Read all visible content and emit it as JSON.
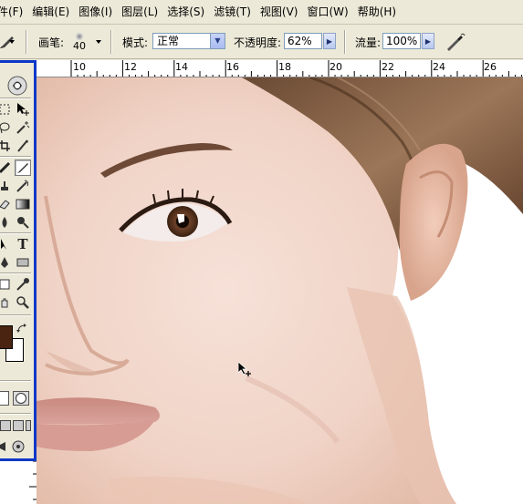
{
  "menu": [
    "文件(F)",
    "编辑(E)",
    "图像(I)",
    "图层(L)",
    "选择(S)",
    "滤镜(T)",
    "视图(V)",
    "窗口(W)",
    "帮助(H)"
  ],
  "options": {
    "brush_label": "画笔:",
    "brush_size": "40",
    "mode_label": "模式:",
    "mode_value": "正常",
    "opacity_label": "不透明度:",
    "opacity_value": "62%",
    "flow_label": "流量:",
    "flow_value": "100%"
  },
  "ruler": {
    "ticks": [
      "10",
      "12",
      "14",
      "16",
      "18",
      "20",
      "22",
      "24",
      "26"
    ]
  },
  "colors": {
    "foreground": "#4a2410",
    "background": "#ffffff",
    "accent": "#0a38c8"
  },
  "icons": [
    "brush-tool-icon",
    "airbrush-icon",
    "move-tool-icon",
    "lasso-icon",
    "magic-wand-icon",
    "crop-icon",
    "slice-icon",
    "healing-icon",
    "brush-icon",
    "stamp-icon",
    "history-brush-icon",
    "eraser-icon",
    "gradient-icon",
    "blur-icon",
    "dodge-icon",
    "pen-icon",
    "type-icon",
    "path-select-icon",
    "shape-icon",
    "notes-icon",
    "eyedropper-icon",
    "hand-icon",
    "zoom-icon",
    "swap-colors-icon",
    "quick-mask-icon",
    "screen-mode-icon",
    "jump-to-imageready-icon"
  ]
}
